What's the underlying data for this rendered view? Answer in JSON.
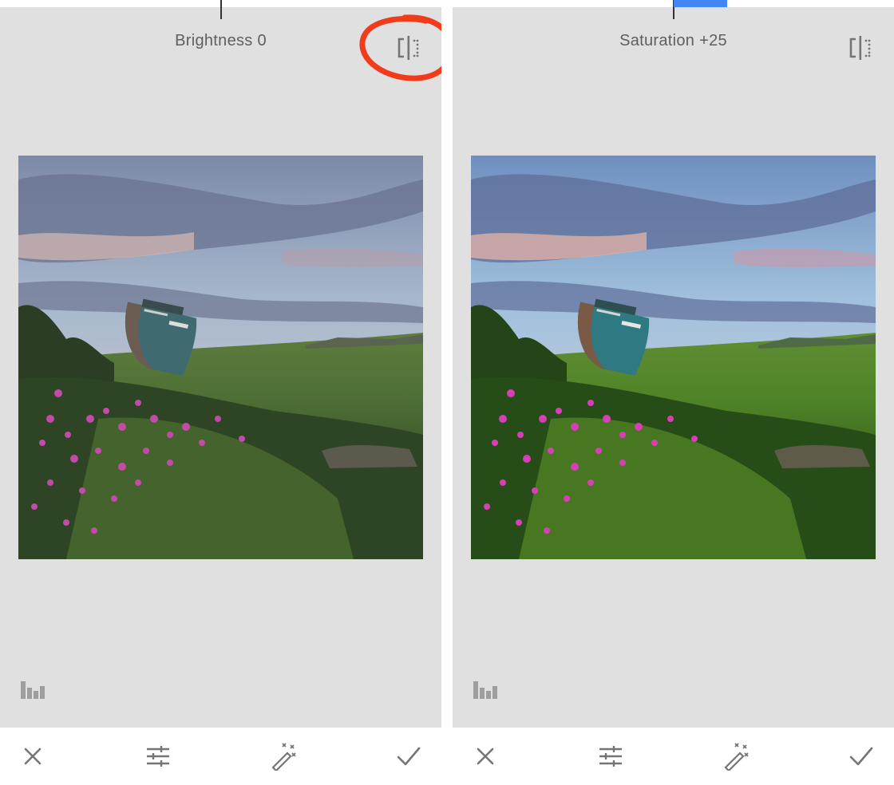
{
  "left_panel": {
    "title": "Brightness 0",
    "compare_icon": "compare-split-icon",
    "histogram_icon": "histogram-icon",
    "toolbar": {
      "cancel_icon": "close-icon",
      "adjust_icon": "tune-sliders-icon",
      "auto_icon": "magic-wand-icon",
      "apply_icon": "check-icon"
    },
    "annotation_color": "#f03c1b"
  },
  "right_panel": {
    "title": "Saturation +25",
    "compare_icon": "compare-split-icon",
    "histogram_icon": "histogram-icon",
    "toolbar": {
      "cancel_icon": "close-icon",
      "adjust_icon": "tune-sliders-icon",
      "auto_icon": "magic-wand-icon",
      "apply_icon": "check-icon"
    },
    "accent_color": "#4285f4"
  },
  "colors": {
    "stage_background": "#e0e0e0",
    "toolbar_background": "#ffffff",
    "text": "#5f5f5f",
    "icon": "#757575"
  }
}
